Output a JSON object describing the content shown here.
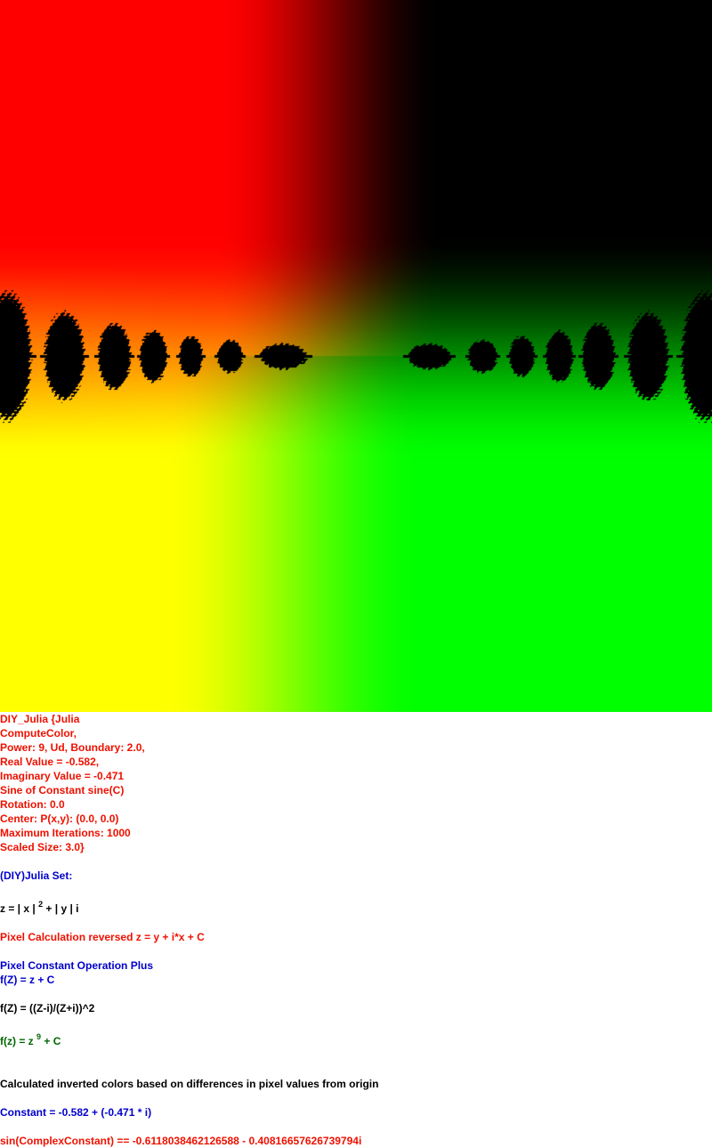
{
  "params": {
    "l1": "DIY_Julia {Julia",
    "l2": "ComputeColor,",
    "l3": "Power: 9, Ud, Boundary: 2.0,",
    "l4": "Real Value = -0.582,",
    "l5": "Imaginary Value = -0.471",
    "l6": "Sine of Constant sine(C)",
    "l7": "Rotation: 0.0",
    "l8": "Center: P(x,y): (0.0, 0.0)",
    "l9": "Maximum Iterations: 1000",
    "l10": "Scaled Size: 3.0}"
  },
  "set_heading": "(DIY)Julia Set:",
  "z_formula": {
    "pre": "z = | x | ",
    "exp": "2",
    "post": " + | y | i"
  },
  "pixel_calc": "Pixel Calculation reversed z = y + i*x + C",
  "const_op": "Pixel Constant Operation Plus",
  "fz1": "f(Z) = z + C",
  "fz2": "f(Z) = ((Z-i)/(Z+i))^2",
  "fz3": {
    "pre": "f(z) = z ",
    "exp": "9",
    "post": " + C"
  },
  "color_note": "Calculated inverted colors based on differences in pixel values from origin",
  "constant": "Constant = -0.582 + (-0.471 * i)",
  "sin_constant": "sin(ComplexConstant) == -0.6118038462126588 - 0.40816657626739794i",
  "colors": {
    "red_text": "#ee1100",
    "blue_text": "#0000cc",
    "green_text": "#006600",
    "fractal_top_left": "#ff0000",
    "fractal_top_right": "#000000",
    "fractal_bottom_left": "#ffff00",
    "fractal_bottom_right": "#00ff00"
  }
}
